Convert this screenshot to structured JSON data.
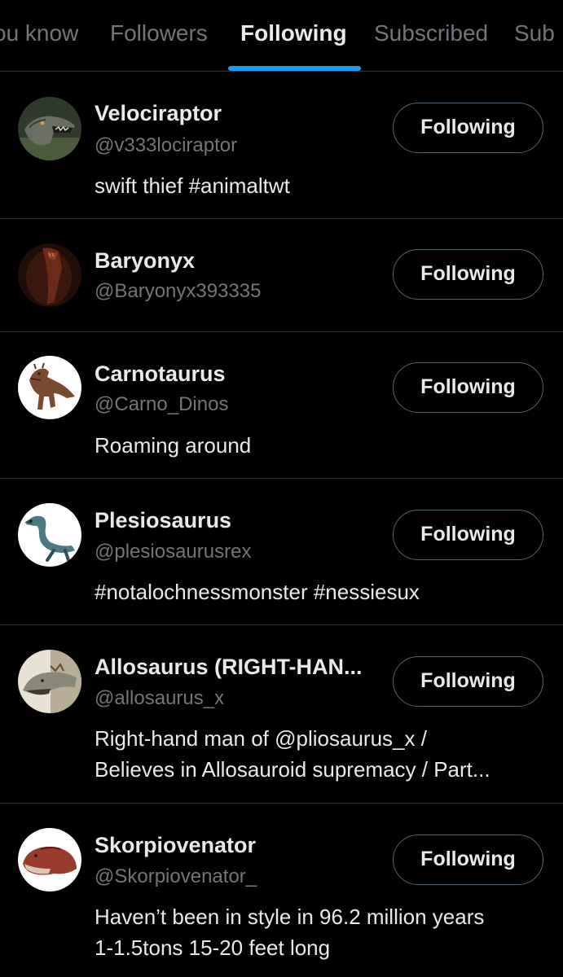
{
  "tabs": [
    {
      "label": "ou know"
    },
    {
      "label": "Followers"
    },
    {
      "label": "Following"
    },
    {
      "label": "Subscribed"
    },
    {
      "label": "Sub"
    }
  ],
  "active_tab": "Following",
  "accent_color": "#1d9bf0",
  "users": [
    {
      "name": "Velociraptor",
      "handle": "@v333lociraptor",
      "bio": "swift thief #animaltwt",
      "button": "Following",
      "avatar_icon": "velociraptor-avatar"
    },
    {
      "name": "Baryonyx",
      "handle": "@Baryonyx393335",
      "bio": "",
      "button": "Following",
      "avatar_icon": "baryonyx-avatar"
    },
    {
      "name": "Carnotaurus",
      "handle": "@Carno_Dinos",
      "bio": "Roaming around",
      "button": "Following",
      "avatar_icon": "carnotaurus-avatar"
    },
    {
      "name": "Plesiosaurus",
      "handle": "@plesiosaurusrex",
      "bio": "#notalochnessmonster #nessiesux",
      "button": "Following",
      "avatar_icon": "plesiosaurus-avatar"
    },
    {
      "name": "Allosaurus (RIGHT-HAN...",
      "handle": "@allosaurus_x",
      "bio_lines": [
        "Right-hand man of @pliosaurus_x /",
        "Believes in Allosauroid supremacy / Part..."
      ],
      "button": "Following",
      "avatar_icon": "allosaurus-avatar"
    },
    {
      "name": "Skorpiovenator",
      "handle": "@Skorpiovenator_",
      "bio_lines": [
        "Haven’t been in style in 96.2 million years",
        "1-1.5tons 15-20 feet long"
      ],
      "button": "Following",
      "avatar_icon": "skorpiovenator-avatar"
    }
  ]
}
